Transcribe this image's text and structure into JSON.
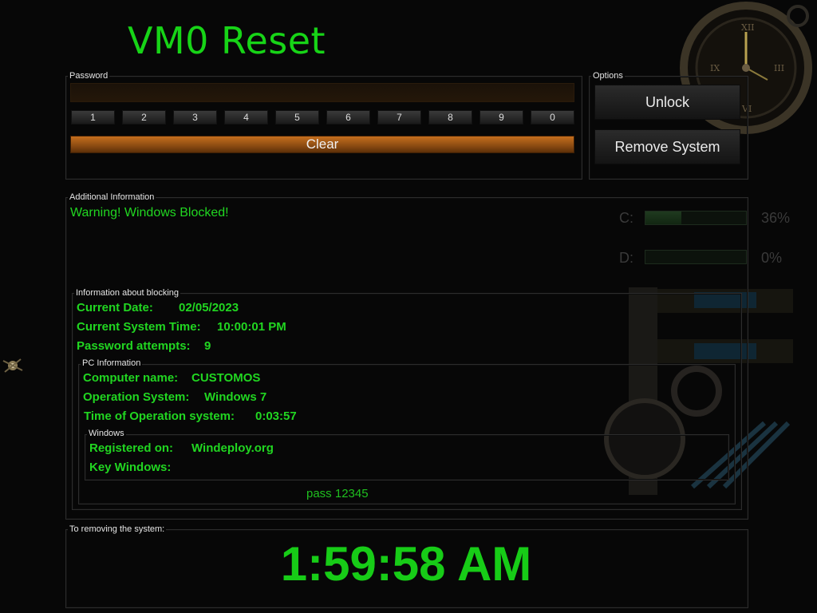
{
  "title": "VM0 Reset",
  "password": {
    "label": "Password",
    "value": "",
    "keys": [
      "1",
      "2",
      "3",
      "4",
      "5",
      "6",
      "7",
      "8",
      "9",
      "0"
    ],
    "clear_label": "Clear"
  },
  "options": {
    "label": "Options",
    "unlock_label": "Unlock",
    "remove_label": "Remove System"
  },
  "additional": {
    "label": "Additional Information",
    "warning": "Warning! Windows Blocked!"
  },
  "drives": [
    {
      "letter": "C:",
      "percent_text": "36%",
      "percent": 36
    },
    {
      "letter": "D:",
      "percent_text": "0%",
      "percent": 0
    }
  ],
  "blocking": {
    "label": "Information about blocking",
    "date_label": "Current Date:",
    "date_value": "02/05/2023",
    "time_label": "Current System Time:",
    "time_value": "10:00:01 PM",
    "attempts_label": "Password attempts:",
    "attempts_value": "9"
  },
  "pc": {
    "label": "PC Information",
    "computer_label": "Computer name:",
    "computer_value": "CUSTOMOS",
    "os_label": "Operation System:",
    "os_value": "Windows 7",
    "uptime_label": "Time of Operation system:",
    "uptime_value": "0:03:57"
  },
  "windows": {
    "label": "Windows",
    "registered_label": "Registered on:",
    "registered_value": "Windeploy.org",
    "key_label": "Key Windows:",
    "key_value": ""
  },
  "pass_note": "pass 12345",
  "removing": {
    "label": "To removing the system:",
    "countdown": "1:59:58 AM"
  },
  "colors": {
    "accent_green": "#21d621",
    "clear_orange": "#c66e1e",
    "background": "#070707"
  }
}
